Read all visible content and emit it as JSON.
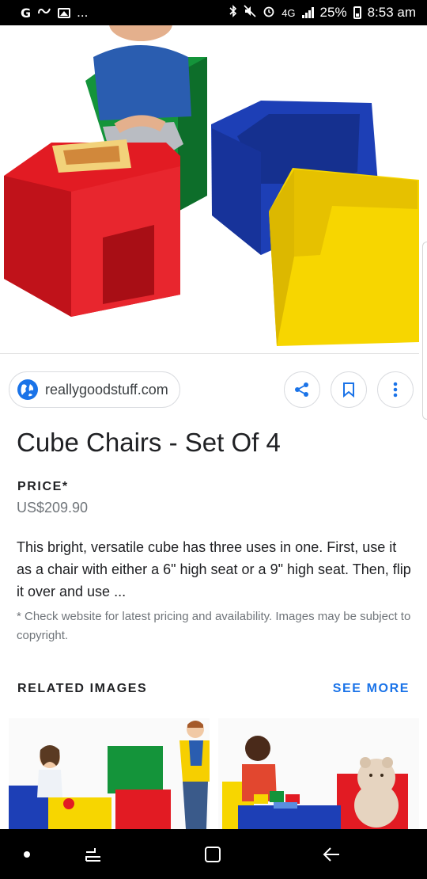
{
  "status_bar": {
    "left_icons": [
      "google-g-icon",
      "link-icon",
      "image-icon",
      "more-icon"
    ],
    "left_glyph_g": "G",
    "more_text": "...",
    "network": "4G",
    "battery": "25%",
    "time": "8:53 am"
  },
  "hero": {
    "description": "cube-chairs-product-photo",
    "colors": {
      "red": "#e21b23",
      "green": "#14943a",
      "blue": "#1d3fb6",
      "yellow": "#f7d600"
    }
  },
  "source": {
    "domain": "reallygoodstuff.com",
    "icon": "globe-icon"
  },
  "actions": [
    {
      "name": "share",
      "icon": "share-icon"
    },
    {
      "name": "save",
      "icon": "bookmark-icon"
    },
    {
      "name": "more",
      "icon": "more-vert-icon"
    }
  ],
  "product": {
    "title": "Cube Chairs - Set Of 4",
    "price_label": "PRICE*",
    "price": "US$209.90",
    "description": "This bright, versatile cube has three uses in one. First, use it as a chair  with either a 6\" high seat or a 9\" high seat. Then, flip it over and use ...",
    "disclaimer": "* Check website for latest pricing and availability. Images may be subject to copyright."
  },
  "related": {
    "label": "RELATED IMAGES",
    "see_more": "SEE MORE"
  },
  "accent_color": "#1a73e8",
  "nav_bar": {
    "items": [
      "dot-icon",
      "recents-icon",
      "home-icon",
      "back-icon"
    ]
  }
}
